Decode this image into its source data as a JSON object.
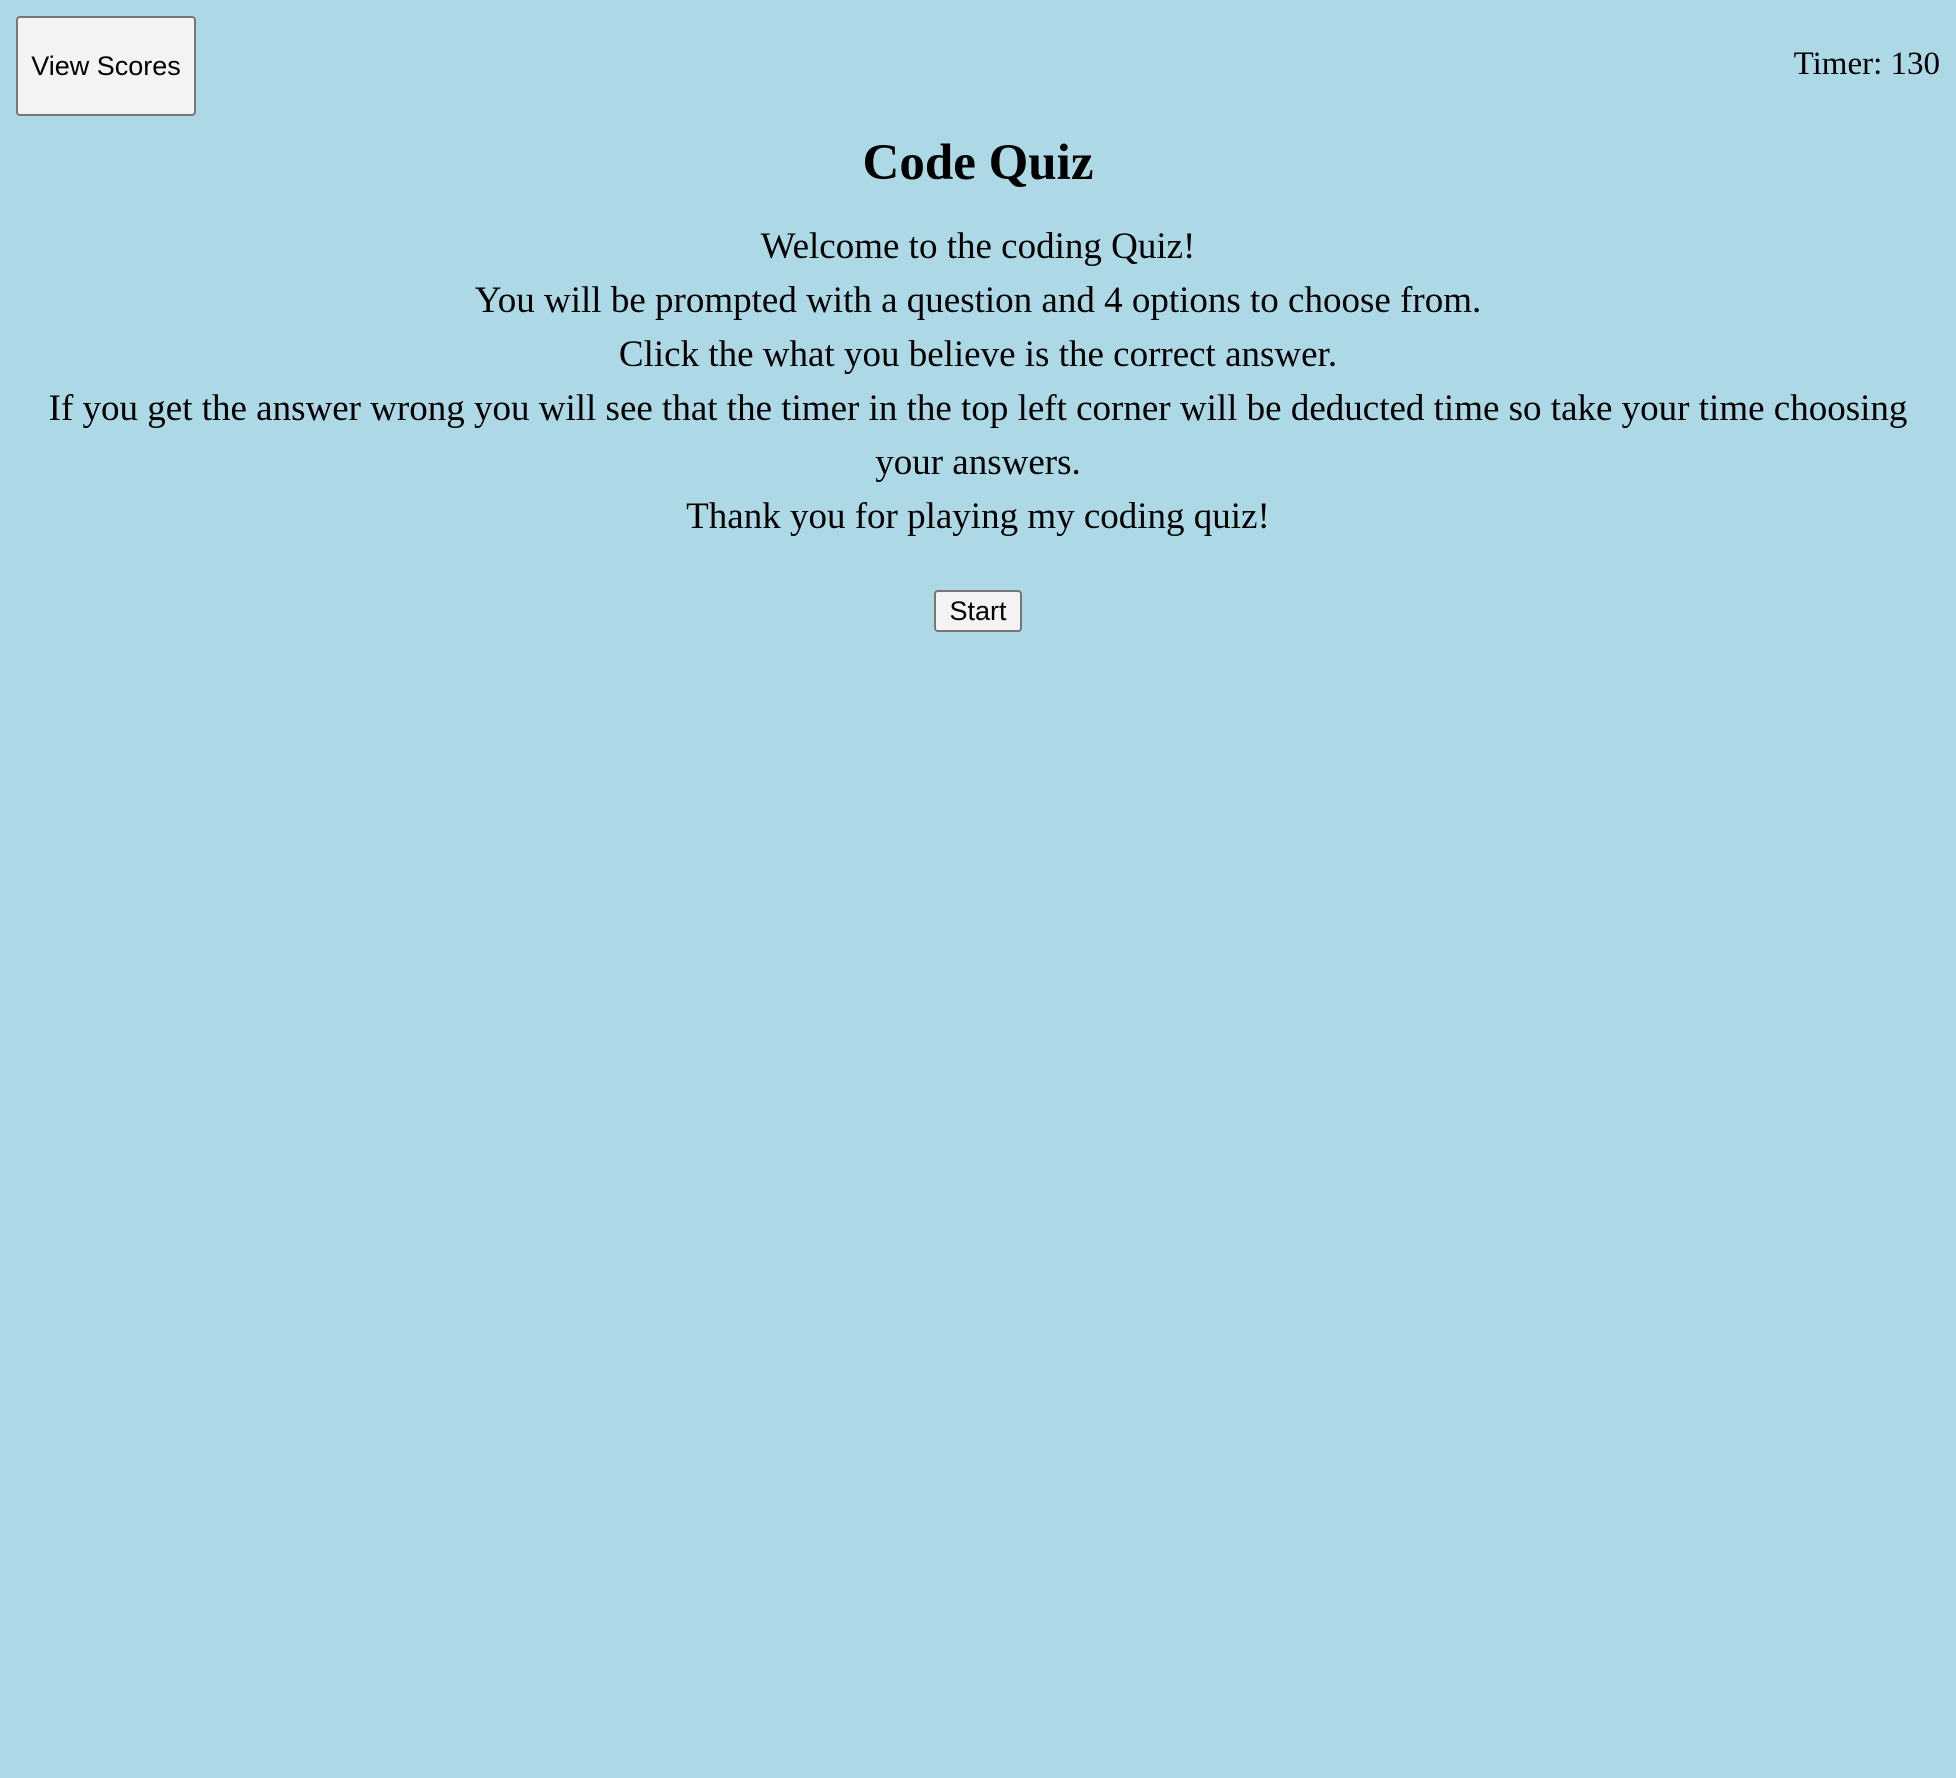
{
  "header": {
    "view_scores_label": "View Scores",
    "timer_label": "Timer:",
    "timer_value": "130"
  },
  "main": {
    "title": "Code Quiz",
    "intro_lines": [
      "Welcome to the coding Quiz!",
      "You will be prompted with a question and 4 options to choose from.",
      "Click the what you believe is the correct answer.",
      "If you get the answer wrong you will see that the timer in the top left corner will be deducted time so take your time choosing your answers.",
      "Thank you for playing my coding quiz!"
    ],
    "start_label": "Start"
  },
  "colors": {
    "background": "#add8e6",
    "button_face": "#f3f3f3",
    "button_border": "#767676"
  }
}
